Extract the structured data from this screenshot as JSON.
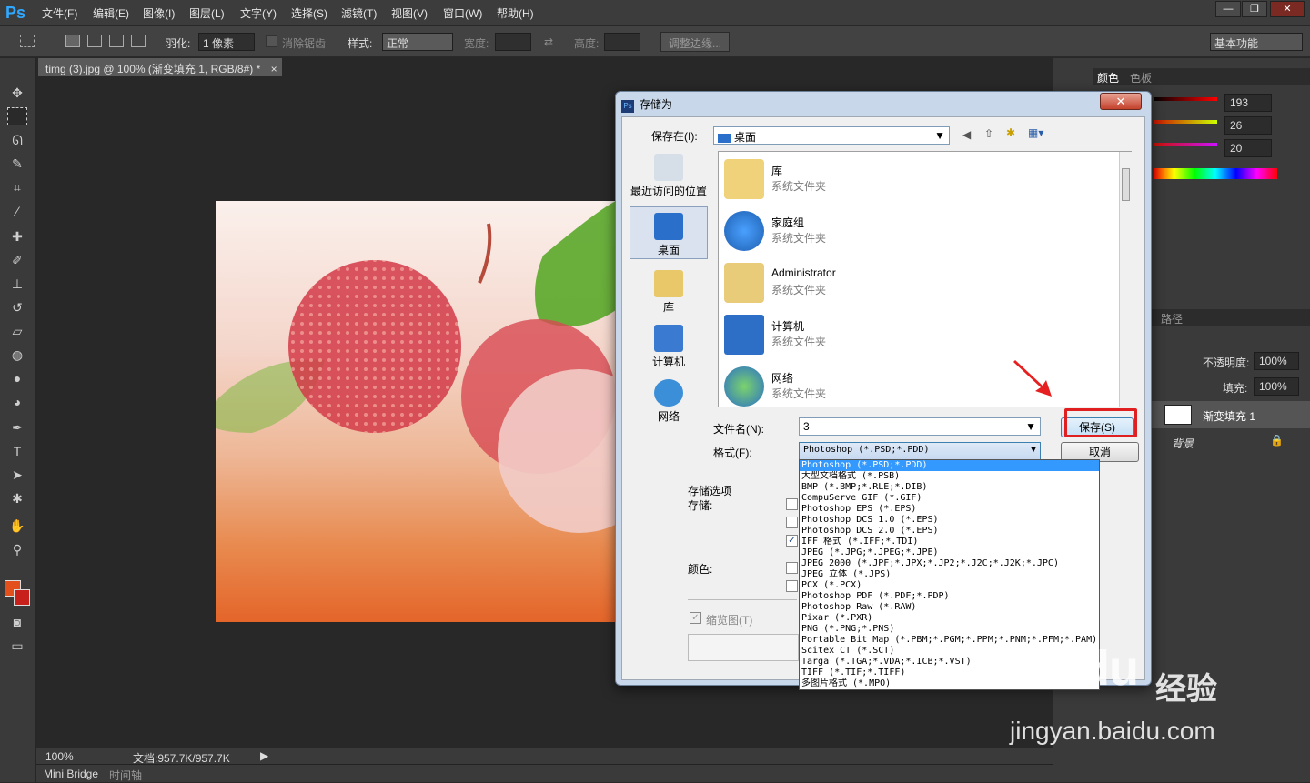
{
  "app": {
    "logo": "Ps"
  },
  "menubar": {
    "items": [
      "文件(F)",
      "编辑(E)",
      "图像(I)",
      "图层(L)",
      "文字(Y)",
      "选择(S)",
      "滤镜(T)",
      "视图(V)",
      "窗口(W)",
      "帮助(H)"
    ],
    "window_buttons": [
      "—",
      "❐",
      "✕"
    ]
  },
  "options": {
    "feather_label": "羽化:",
    "feather_value": "1 像素",
    "antialias_label": "消除锯齿",
    "style_label": "样式:",
    "style_value": "正常",
    "width_label": "宽度:",
    "height_label": "高度:",
    "refine_edge": "调整边缘...",
    "workspace": "基本功能"
  },
  "document": {
    "tab_title": "timg (3).jpg @ 100% (渐变填充 1, RGB/8#) *",
    "tab_close": "×"
  },
  "status": {
    "zoom": "100%",
    "doc_info": "文档:957.7K/957.7K"
  },
  "bottom_tabs": [
    "Mini Bridge",
    "时间轴"
  ],
  "right_panel": {
    "color_tabs": [
      "颜色",
      "色板"
    ],
    "rgb_values": [
      "193",
      "26",
      "20"
    ],
    "paths_tab": "路径",
    "opacity_label": "不透明度:",
    "opacity_value": "100%",
    "fill_label": "填充:",
    "fill_value": "100%",
    "layers": [
      {
        "name": "渐变填充 1"
      },
      {
        "name": "背景"
      }
    ]
  },
  "dialog": {
    "title": "存储为",
    "close": "✕",
    "save_in_label": "保存在(I):",
    "save_in_value": "桌面",
    "places": [
      "最近访问的位置",
      "桌面",
      "库",
      "计算机",
      "网络"
    ],
    "files": [
      {
        "name": "库",
        "sub": "系统文件夹"
      },
      {
        "name": "家庭组",
        "sub": "系统文件夹"
      },
      {
        "name": "Administrator",
        "sub": "系统文件夹"
      },
      {
        "name": "计算机",
        "sub": "系统文件夹"
      },
      {
        "name": "网络",
        "sub": "系统文件夹"
      }
    ],
    "filename_label": "文件名(N):",
    "filename_value": "3",
    "format_label": "格式(F):",
    "format_value": "Photoshop (*.PSD;*.PDD)",
    "save_button": "保存(S)",
    "cancel_button": "取消",
    "save_options_label": "存储选项",
    "save_label": "存储:",
    "color_label": "颜色:",
    "thumbnail_label": "缩览图(T)",
    "format_options": [
      "Photoshop (*.PSD;*.PDD)",
      "大型文档格式 (*.PSB)",
      "BMP (*.BMP;*.RLE;*.DIB)",
      "CompuServe GIF (*.GIF)",
      "Photoshop EPS (*.EPS)",
      "Photoshop DCS 1.0 (*.EPS)",
      "Photoshop DCS 2.0 (*.EPS)",
      "IFF 格式 (*.IFF;*.TDI)",
      "JPEG (*.JPG;*.JPEG;*.JPE)",
      "JPEG 2000 (*.JPF;*.JPX;*.JP2;*.J2C;*.J2K;*.JPC)",
      "JPEG 立体 (*.JPS)",
      "PCX (*.PCX)",
      "Photoshop PDF (*.PDF;*.PDP)",
      "Photoshop Raw (*.RAW)",
      "Pixar (*.PXR)",
      "PNG (*.PNG;*.PNS)",
      "Portable Bit Map (*.PBM;*.PGM;*.PPM;*.PNM;*.PFM;*.PAM)",
      "Scitex CT (*.SCT)",
      "Targa (*.TGA;*.VDA;*.ICB;*.VST)",
      "TIFF (*.TIF;*.TIFF)",
      "多图片格式 (*.MPO)"
    ]
  },
  "watermark": {
    "brand": "Baidu",
    "brand_suffix": "经验",
    "url": "jingyan.baidu.com"
  },
  "colors": {
    "accent_red": "#e02020",
    "foreground": "#e4501c",
    "background_swatch": "#c8201a"
  }
}
